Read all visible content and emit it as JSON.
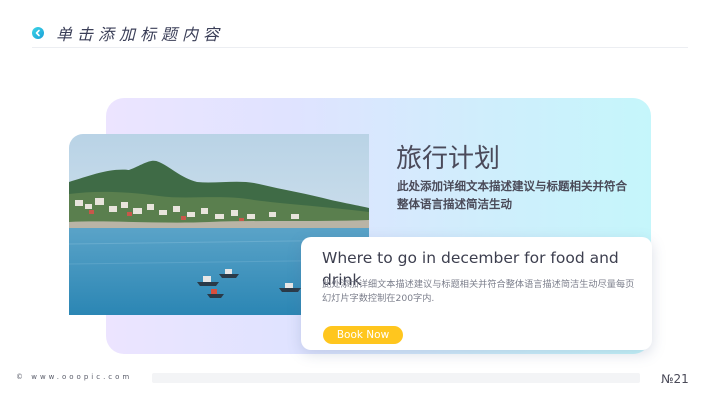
{
  "header": {
    "title": "单击添加标题内容",
    "icon": "chevron-left-icon",
    "accent": "#1fb3de"
  },
  "main": {
    "title": "旅行计划",
    "description": "此处添加详细文本描述建议与标题相关并符合整体语言描述简洁生动"
  },
  "card": {
    "title": "Where to go in december for food and drink",
    "description": "此处添加详细文本描述建议与标题相关并符合整体语言描述简洁生动尽量每页幻灯片字数控制在200字内.",
    "button_label": "Book Now",
    "button_color": "#ffc61e"
  },
  "footer": {
    "site": "© www.ooopic.com",
    "page_number": "№21"
  },
  "panel_gradient": [
    "#ece4ff",
    "#c5f6fb"
  ]
}
